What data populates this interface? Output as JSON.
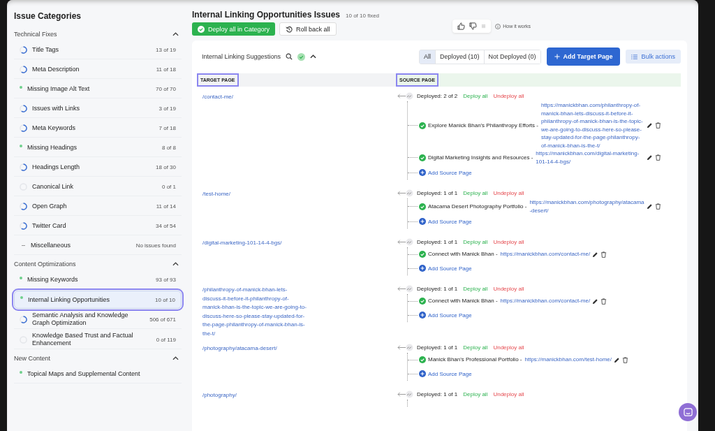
{
  "sidebar": {
    "title": "Issue Categories",
    "groups": [
      {
        "label": "Technical Fixes",
        "expanded": true,
        "items": [
          {
            "label": "Title Tags",
            "count": "13 of 19",
            "kind": "progress",
            "selected": false
          },
          {
            "label": "Meta Description",
            "count": "11 of 18",
            "kind": "progress",
            "selected": false
          },
          {
            "label": "Missing Image Alt Text",
            "count": "70 of 70",
            "kind": "complete",
            "selected": false
          },
          {
            "label": "Issues with Links",
            "count": "3 of 19",
            "kind": "progress",
            "selected": false
          },
          {
            "label": "Meta Keywords",
            "count": "7 of 18",
            "kind": "progress",
            "selected": false
          },
          {
            "label": "Missing Headings",
            "count": "8 of 8",
            "kind": "complete",
            "selected": false
          },
          {
            "label": "Headings Length",
            "count": "18 of 30",
            "kind": "progress",
            "selected": false
          },
          {
            "label": "Canonical Link",
            "count": "0 of 1",
            "kind": "pending",
            "selected": false
          },
          {
            "label": "Open Graph",
            "count": "11 of 14",
            "kind": "progress",
            "selected": false
          },
          {
            "label": "Twitter Card",
            "count": "34 of 54",
            "kind": "progress",
            "selected": false
          },
          {
            "label": "Miscellaneous",
            "count": "No issues found",
            "kind": "none",
            "selected": false
          }
        ]
      },
      {
        "label": "Content Optimizations",
        "expanded": true,
        "items": [
          {
            "label": "Missing Keywords",
            "count": "93 of 93",
            "kind": "complete",
            "selected": false
          },
          {
            "label": "Internal Linking Opportunities",
            "count": "10 of 10",
            "kind": "complete",
            "selected": true
          },
          {
            "label": "Semantic Analysis and Knowledge Graph Optimization",
            "count": "506 of 671",
            "kind": "progress",
            "selected": false
          },
          {
            "label": "Knowledge Based Trust and Factual Enhancement",
            "count": "0 of 119",
            "kind": "pending",
            "selected": false
          }
        ]
      },
      {
        "label": "New Content",
        "expanded": true,
        "items": [
          {
            "label": "Topical Maps and Supplemental Content",
            "kind": "complete",
            "selected": false
          }
        ]
      }
    ]
  },
  "header": {
    "title": "Internal Linking Opportunities Issues",
    "fixed": "10 of 10 fixed",
    "deploy_button": "Deploy all in Category",
    "rollback_button": "Roll back all",
    "how_it_works": "How it works"
  },
  "panel": {
    "title": "Internal Linking Suggestions",
    "filters": [
      {
        "label": "All",
        "selected": true
      },
      {
        "label": "Deployed (10)",
        "selected": false
      },
      {
        "label": "Not Deployed (0)",
        "selected": false
      }
    ],
    "add_button": "Add Target Page",
    "bulk_button": "Bulk actions"
  },
  "table": {
    "columns": [
      {
        "label": "TARGET PAGE",
        "outlined": true
      },
      {
        "label": "SOURCE PAGE",
        "outlined": true
      }
    ],
    "rows": [
      {
        "target": "/contact-me/",
        "deployed": "Deployed: 2 of 2",
        "deploy_all": "Deploy all",
        "undeploy_all": "Undeploy all",
        "add_source": "Add Source Page",
        "sources": [
          {
            "title": "Explore Manick Bhan's Philanthropy Efforts -",
            "url": "https://manickbhan.com/philanthropy-of-manick-bhan-lets-discuss-it-before-it-philanthropy-of-manick-bhan-is-the-topic-we-are-going-to-discuss-here-so-please-stay-updated-for-the-page-philanthropy-of-manick-bhan-is-the-t/",
            "deployed": true
          },
          {
            "title": "Digital Marketing Insights and Resources -",
            "url": "https://manickbhan.com/digital-marketing-101-14-4-bgs/",
            "deployed": true
          }
        ]
      },
      {
        "target": "/test-home/",
        "deployed": "Deployed: 1 of 1",
        "deploy_all": "Deploy all",
        "undeploy_all": "Undeploy all",
        "add_source": "Add Source Page",
        "sources": [
          {
            "title": "Atacama Desert Photography Portfolio -",
            "url": "https://manickbhan.com/photography/atacama-desert/",
            "deployed": true
          }
        ]
      },
      {
        "target": "/digital-marketing-101-14-4-bgs/",
        "deployed": "Deployed: 1 of 1",
        "deploy_all": "Deploy all",
        "undeploy_all": "Undeploy all",
        "add_source": "Add Source Page",
        "sources": [
          {
            "title": "Connect with Manick Bhan -",
            "url": "https://manickbhan.com/contact-me/",
            "deployed": true
          }
        ]
      },
      {
        "target": "/philanthropy-of-manick-bhan-lets-discuss-it-before-it-philanthropy-of-manick-bhan-is-the-topic-we-are-going-to-discuss-here-so-please-stay-updated-for-the-page-philanthropy-of-manick-bhan-is-the-t/",
        "deployed": "Deployed: 1 of 1",
        "deploy_all": "Deploy all",
        "undeploy_all": "Undeploy all",
        "add_source": "Add Source Page",
        "sources": [
          {
            "title": "Connect with Manick Bhan -",
            "url": "https://manickbhan.com/contact-me/",
            "deployed": true
          }
        ]
      },
      {
        "target": "/photography/atacama-desert/",
        "deployed": "Deployed: 1 of 1",
        "deploy_all": "Deploy all",
        "undeploy_all": "Undeploy all",
        "add_source": "Add Source Page",
        "sources": [
          {
            "title": "Manick Bhan's Professional Portfolio -",
            "url": "https://manickbhan.com/test-home/",
            "deployed": true
          }
        ]
      },
      {
        "target": "/photography/",
        "deployed": "Deployed: 1 of 1",
        "deploy_all": "Deploy all",
        "undeploy_all": "Undeploy all"
      }
    ]
  }
}
